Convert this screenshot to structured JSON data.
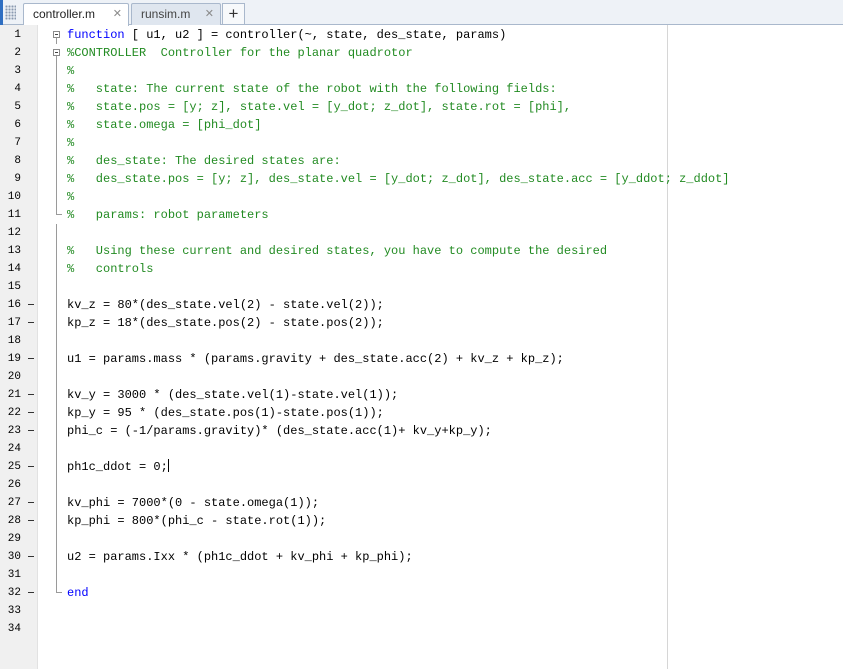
{
  "tabs": [
    {
      "label": "controller.m",
      "active": true
    },
    {
      "label": "runsim.m",
      "active": false
    }
  ],
  "add_tab_label": "+",
  "close_glyph": "✕",
  "colors": {
    "keyword": "#0000ff",
    "comment": "#228b22",
    "text": "#000000",
    "gutter": "#f0f0f0"
  },
  "icons": [
    "grip-icon",
    "close-icon",
    "plus-icon",
    "fold-toggle-icon"
  ],
  "editor": {
    "lines": [
      {
        "num": "1",
        "bp": false,
        "fold": "open",
        "segs": [
          {
            "t": "function",
            "c": "kw"
          },
          {
            "t": " [ u1, u2 ] = controller(~, state, des_state, params)"
          }
        ]
      },
      {
        "num": "2",
        "bp": false,
        "fold": "open2",
        "segs": [
          {
            "t": "%CONTROLLER  Controller for the planar quadrotor",
            "c": "cm"
          }
        ]
      },
      {
        "num": "3",
        "bp": false,
        "fold": "mid",
        "segs": [
          {
            "t": "%",
            "c": "cm"
          }
        ]
      },
      {
        "num": "4",
        "bp": false,
        "fold": "mid",
        "segs": [
          {
            "t": "%   state: The current state of the robot with the following fields:",
            "c": "cm"
          }
        ]
      },
      {
        "num": "5",
        "bp": false,
        "fold": "mid",
        "segs": [
          {
            "t": "%   state.pos = [y; z], state.vel = [y_dot; z_dot], state.rot = [phi],",
            "c": "cm"
          }
        ]
      },
      {
        "num": "6",
        "bp": false,
        "fold": "mid",
        "segs": [
          {
            "t": "%   state.omega = [phi_dot]",
            "c": "cm"
          }
        ]
      },
      {
        "num": "7",
        "bp": false,
        "fold": "mid",
        "segs": [
          {
            "t": "%",
            "c": "cm"
          }
        ]
      },
      {
        "num": "8",
        "bp": false,
        "fold": "mid",
        "segs": [
          {
            "t": "%   des_state: The desired states are:",
            "c": "cm"
          }
        ]
      },
      {
        "num": "9",
        "bp": false,
        "fold": "mid",
        "segs": [
          {
            "t": "%   des_state.pos = [y; z], des_state.vel = [y_dot; z_dot], des_state.acc = [y_ddot; z_ddot]",
            "c": "cm"
          }
        ]
      },
      {
        "num": "10",
        "bp": false,
        "fold": "mid",
        "segs": [
          {
            "t": "%",
            "c": "cm"
          }
        ]
      },
      {
        "num": "11",
        "bp": false,
        "fold": "end",
        "segs": [
          {
            "t": "%   params: robot parameters",
            "c": "cm"
          }
        ]
      },
      {
        "num": "12",
        "bp": false,
        "fold": "mid",
        "segs": []
      },
      {
        "num": "13",
        "bp": false,
        "fold": "mid",
        "segs": [
          {
            "t": "%   Using these current and desired states, you have to compute the desired",
            "c": "cm"
          }
        ]
      },
      {
        "num": "14",
        "bp": false,
        "fold": "mid",
        "segs": [
          {
            "t": "%   controls",
            "c": "cm"
          }
        ]
      },
      {
        "num": "15",
        "bp": false,
        "fold": "mid",
        "segs": []
      },
      {
        "num": "16",
        "bp": true,
        "fold": "mid",
        "segs": [
          {
            "t": "kv_z = 80*(des_state.vel(2) - state.vel(2));"
          }
        ]
      },
      {
        "num": "17",
        "bp": true,
        "fold": "mid",
        "segs": [
          {
            "t": "kp_z = 18*(des_state.pos(2) - state.pos(2));"
          }
        ]
      },
      {
        "num": "18",
        "bp": false,
        "fold": "mid",
        "segs": []
      },
      {
        "num": "19",
        "bp": true,
        "fold": "mid",
        "segs": [
          {
            "t": "u1 = params.mass * (params.gravity + des_state.acc(2) + kv_z + kp_z);"
          }
        ]
      },
      {
        "num": "20",
        "bp": false,
        "fold": "mid",
        "segs": []
      },
      {
        "num": "21",
        "bp": true,
        "fold": "mid",
        "segs": [
          {
            "t": "kv_y = 3000 * (des_state.vel(1)-state.vel(1));"
          }
        ]
      },
      {
        "num": "22",
        "bp": true,
        "fold": "mid",
        "segs": [
          {
            "t": "kp_y = 95 * (des_state.pos(1)-state.pos(1));"
          }
        ]
      },
      {
        "num": "23",
        "bp": true,
        "fold": "mid",
        "segs": [
          {
            "t": "phi_c = (-1/params.gravity)* (des_state.acc(1)+ kv_y+kp_y);"
          }
        ]
      },
      {
        "num": "24",
        "bp": false,
        "fold": "mid",
        "segs": []
      },
      {
        "num": "25",
        "bp": true,
        "fold": "mid",
        "caret": true,
        "segs": [
          {
            "t": "ph1c_ddot = 0;"
          }
        ]
      },
      {
        "num": "26",
        "bp": false,
        "fold": "mid",
        "segs": []
      },
      {
        "num": "27",
        "bp": true,
        "fold": "mid",
        "segs": [
          {
            "t": "kv_phi = 7000*(0 - state.omega(1));"
          }
        ]
      },
      {
        "num": "28",
        "bp": true,
        "fold": "mid",
        "segs": [
          {
            "t": "kp_phi = 800*(phi_c - state.rot(1));"
          }
        ]
      },
      {
        "num": "29",
        "bp": false,
        "fold": "mid",
        "segs": []
      },
      {
        "num": "30",
        "bp": true,
        "fold": "mid",
        "segs": [
          {
            "t": "u2 = params.Ixx * (ph1c_ddot + kv_phi + kp_phi);"
          }
        ]
      },
      {
        "num": "31",
        "bp": false,
        "fold": "mid",
        "segs": []
      },
      {
        "num": "32",
        "bp": true,
        "fold": "end",
        "segs": [
          {
            "t": "end",
            "c": "kw"
          }
        ]
      },
      {
        "num": "33",
        "bp": false,
        "fold": "",
        "segs": []
      },
      {
        "num": "34",
        "bp": false,
        "fold": "",
        "segs": []
      }
    ]
  }
}
